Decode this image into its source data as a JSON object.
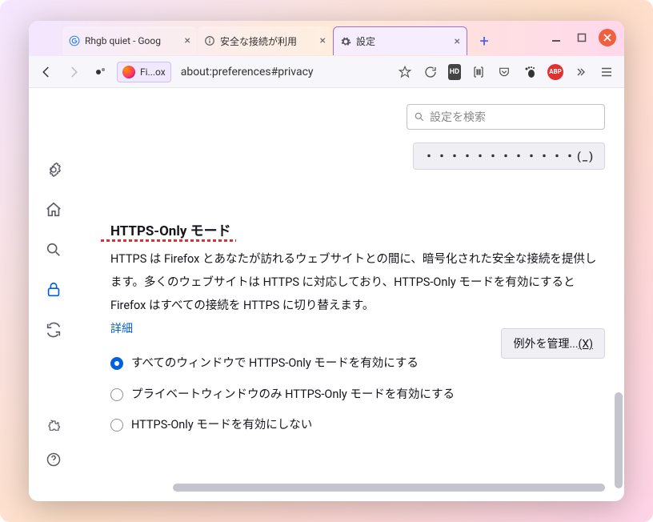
{
  "tabs": [
    {
      "label": "Rhgb quiet - Goog",
      "icon": "google"
    },
    {
      "label": "安全な接続が利用",
      "icon": "info"
    },
    {
      "label": "設定",
      "icon": "gear",
      "active": true
    }
  ],
  "url": "about:preferences#privacy",
  "identity_label": "Fi...ox",
  "search_placeholder": "設定を検索",
  "top_button_fragment": "・・・・・・・・・・・・(_)",
  "section": {
    "title": "HTTPS-Only モード",
    "desc": "HTTPS は Firefox とあなたが訪れるウェブサイトとの間に、暗号化された安全な接続を提供します。多くのウェブサイトは HTTPS に対応しており、HTTPS-Only モードを有効にすると Firefox はすべての接続を HTTPS に切り替えます。",
    "learn_more": "詳細",
    "options": [
      "すべてのウィンドウで HTTPS-Only モードを有効にする",
      "プライベートウィンドウのみ HTTPS-Only モードを有効にする",
      "HTTPS-Only モードを有効にしない"
    ],
    "selected": 0,
    "manage_exceptions": "例外を管理...",
    "manage_accesskey": "(X)"
  },
  "toolbar_hd": "HD",
  "toolbar_abp": "ABP"
}
